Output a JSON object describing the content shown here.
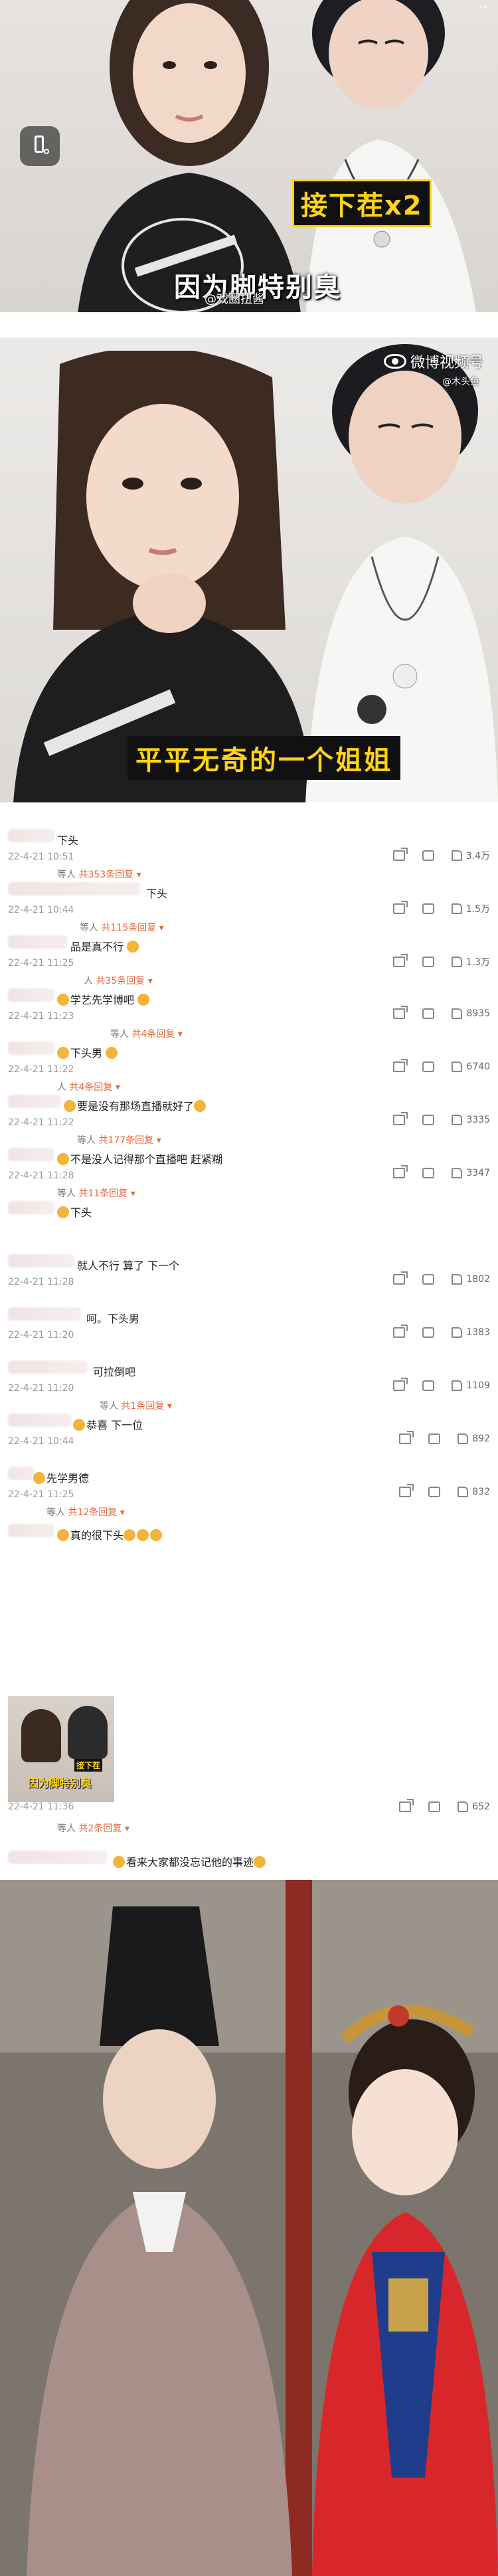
{
  "frame1": {
    "caption_yellow": "接下茬x2",
    "caption_white": "因为脚特别臭",
    "watermark": "@戏圈扭酱",
    "corner": "••"
  },
  "frame2": {
    "weibo_watermark": "微博视频号",
    "weibo_sub": "@木头鱼",
    "caption": "平平无奇的一个姐姐"
  },
  "comments": [
    {
      "text": "下头",
      "date": "22-4-21 10:51",
      "replies": "共353条回复",
      "prefix": "等人",
      "likes": "3.4万"
    },
    {
      "text": "下头",
      "date": "22-4-21 10:44",
      "replies": "共115条回复",
      "prefix": "等人",
      "likes": "1.5万"
    },
    {
      "text": "品是真不行",
      "date": "22-4-21 11:25",
      "replies": "共35条回复",
      "prefix": "人",
      "likes": "1.3万"
    },
    {
      "text": "学艺先学博吧",
      "date": "22-4-21 11:23",
      "replies": "共4条回复",
      "prefix": "等人",
      "likes": "8935"
    },
    {
      "text": "下头男",
      "date": "22-4-21 11:22",
      "replies": "共4条回复",
      "prefix": "人",
      "likes": "6740"
    },
    {
      "text": "要是没有那场直播就好了",
      "date": "22-4-21 11:22",
      "replies": "共177条回复",
      "prefix": "等人",
      "likes": "3335"
    },
    {
      "text": "不是没人记得那个直播吧 赶紧糊",
      "date": "22-4-21 11:28",
      "replies": "共11条回复",
      "prefix": "等人",
      "likes": "3347"
    },
    {
      "text": "下头",
      "date": "",
      "replies": "",
      "prefix": "",
      "likes": ""
    },
    {
      "text": "就人不行 算了 下一个",
      "date": "22-4-21 11:28",
      "replies": "",
      "prefix": "",
      "likes": "1802"
    },
    {
      "text": "呵。下头男",
      "date": "22-4-21 11:20",
      "replies": "",
      "prefix": "",
      "likes": "1383"
    },
    {
      "text": "可拉倒吧",
      "date": "22-4-21 11:20",
      "replies": "共1条回复",
      "prefix": "等人",
      "likes": "1109"
    },
    {
      "text": "恭喜 下一位",
      "date": "22-4-21 10:44",
      "replies": "",
      "prefix": "",
      "likes": "892"
    },
    {
      "text": "先学男德",
      "date": "22-4-21 11:25",
      "replies": "共12条回复",
      "prefix": "等人",
      "likes": "832"
    },
    {
      "text": "真的很下头",
      "date": "22-4-21 11:36",
      "replies": "共2条回复",
      "prefix": "等人",
      "likes": "652"
    },
    {
      "text": "看来大家都没忘记他的事迹",
      "date": "",
      "replies": "",
      "prefix": "",
      "likes": ""
    }
  ],
  "thumb": {
    "caption": "因为脚特别臭",
    "caption2": "接下茬"
  },
  "colors": {
    "accent_orange": "#e8693a",
    "caption_yellow": "#ffd318"
  }
}
